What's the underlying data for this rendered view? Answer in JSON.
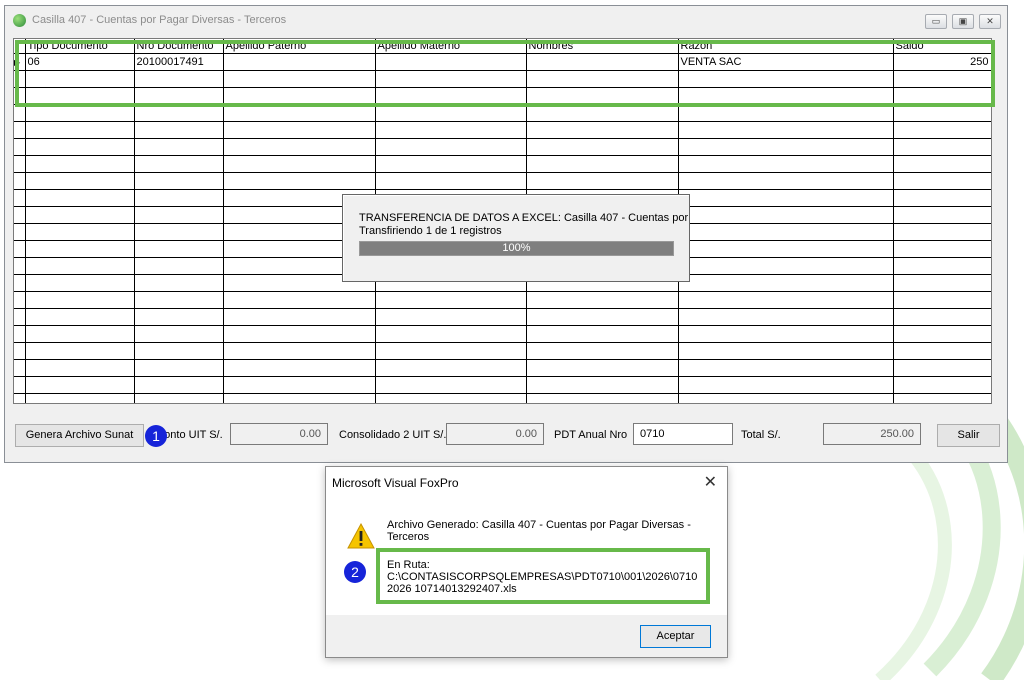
{
  "window": {
    "title": "Casilla 407 - Cuentas por Pagar Diversas - Terceros",
    "controls": [
      "minimize",
      "maximize",
      "close"
    ]
  },
  "grid": {
    "columns": [
      "Tipo Documento",
      "Nro Documento",
      "Apellido Paterno",
      "Apellido Materno",
      "Nombres",
      "Razon",
      "Saldo"
    ],
    "rows": [
      [
        "06",
        "20100017491",
        "",
        "",
        "",
        "VENTA SAC",
        "250"
      ]
    ],
    "current_row_marker": "▶"
  },
  "progress": {
    "title": "TRANSFERENCIA DE DATOS A EXCEL: Casilla 407 - Cuentas por",
    "subtitle": "Transfiriendo 1 de 1 registros",
    "percent_label": "100%",
    "percent": 100
  },
  "bottom": {
    "generate_button": "Genera Archivo Sunat",
    "monto_uit_label": "Monto UIT S/.",
    "monto_uit_value": "0.00",
    "consolidado_label": "Consolidado 2 UIT S/.",
    "consolidado_value": "0.00",
    "pdt_label": "PDT Anual Nro",
    "pdt_value": "0710",
    "total_label": "Total S/.",
    "total_value": "250.00",
    "exit_button": "Salir"
  },
  "callouts": {
    "one": "1",
    "two": "2"
  },
  "message": {
    "title": "Microsoft Visual FoxPro",
    "close": "✕",
    "line1": "Archivo Generado: Casilla 407 - Cuentas por Pagar Diversas - Terceros",
    "route_label": "En Ruta:",
    "route_path": "C:\\CONTASISCORPSQLEMPRESAS\\PDT0710\\001\\2026\\07102026 10714013292407.xls",
    "ok_button": "Aceptar",
    "icon": "warning-icon"
  },
  "colors": {
    "highlight": "#67b94a",
    "badge": "#1624d9",
    "progress_fill": "#7f7f7f"
  }
}
